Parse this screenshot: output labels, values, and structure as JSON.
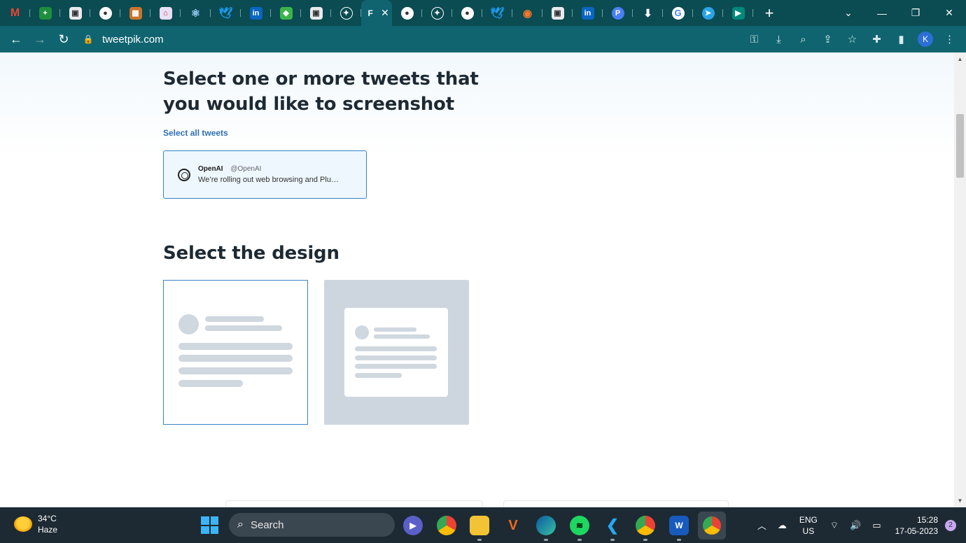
{
  "browser": {
    "active_tab_label": "F",
    "url": "tweetpik.com",
    "tabs_icons": [
      "gmail-icon",
      "sheets-icon",
      "app-icon",
      "chrome-icon",
      "image-icon",
      "store-icon",
      "react-icon",
      "twitter-icon",
      "linkedin-icon",
      "leaf-icon",
      "app-icon",
      "ai-icon"
    ],
    "tabs_icons_after": [
      "chrome-icon",
      "ai-icon",
      "chrome-icon",
      "twitter-icon",
      "blender-icon",
      "app-icon",
      "linkedin-icon",
      "p-icon",
      "download-icon",
      "google-icon",
      "telegram-icon",
      "meet-icon"
    ]
  },
  "page": {
    "heading_tweets": "Select one or more tweets that you would like to screenshot",
    "select_all": "Select all tweets",
    "tweet": {
      "name": "OpenAI",
      "handle": "@OpenAI",
      "text": "We’re rolling out web browsing and Plu…"
    },
    "heading_design": "Select the design"
  },
  "taskbar": {
    "temperature": "34°C",
    "condition": "Haze",
    "search_label": "Search",
    "lang_top": "ENG",
    "lang_bottom": "US",
    "time": "15:28",
    "date": "17-05-2023",
    "notifications": "2",
    "profile_initial": "K"
  },
  "colors": {
    "tabstrip": "#0b4b52",
    "toolbar": "#0f6470",
    "accent_blue": "#3b82c9",
    "taskbar": "#1d2a33"
  }
}
